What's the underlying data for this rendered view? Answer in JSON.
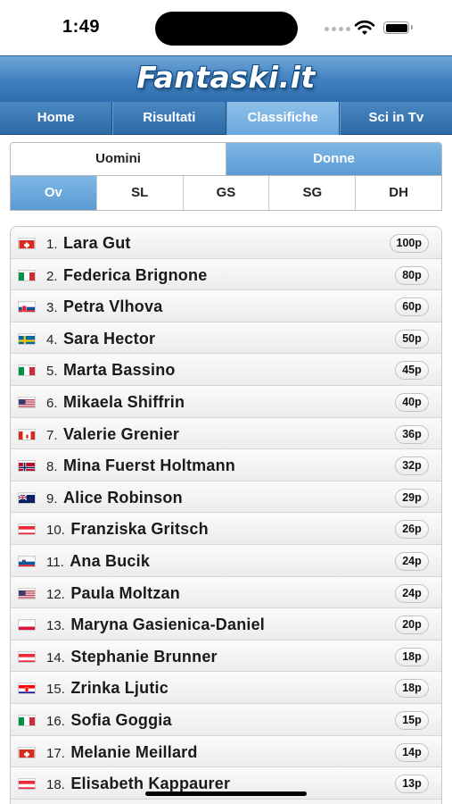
{
  "status_bar": {
    "time": "1:49",
    "icons": [
      "signal-dots-icon",
      "wifi-icon",
      "battery-icon"
    ]
  },
  "header": {
    "logo_text": "Fantaski.it",
    "nav": [
      {
        "label": "Home",
        "active": false
      },
      {
        "label": "Risultati",
        "active": false
      },
      {
        "label": "Classifiche",
        "active": true
      },
      {
        "label": "Sci in Tv",
        "active": false
      }
    ]
  },
  "gender_tabs": [
    {
      "label": "Uomini",
      "active": false
    },
    {
      "label": "Donne",
      "active": true
    }
  ],
  "discipline_tabs": [
    {
      "label": "Ov",
      "active": true
    },
    {
      "label": "SL",
      "active": false
    },
    {
      "label": "GS",
      "active": false
    },
    {
      "label": "SG",
      "active": false
    },
    {
      "label": "DH",
      "active": false
    }
  ],
  "ranking": [
    {
      "rank": "1.",
      "name": "Lara Gut",
      "points": "100p",
      "flag": "SUI"
    },
    {
      "rank": "2.",
      "name": "Federica Brignone",
      "points": "80p",
      "flag": "ITA"
    },
    {
      "rank": "3.",
      "name": "Petra Vlhova",
      "points": "60p",
      "flag": "SVK"
    },
    {
      "rank": "4.",
      "name": "Sara Hector",
      "points": "50p",
      "flag": "SWE"
    },
    {
      "rank": "5.",
      "name": "Marta Bassino",
      "points": "45p",
      "flag": "ITA"
    },
    {
      "rank": "6.",
      "name": "Mikaela Shiffrin",
      "points": "40p",
      "flag": "USA"
    },
    {
      "rank": "7.",
      "name": "Valerie Grenier",
      "points": "36p",
      "flag": "CAN"
    },
    {
      "rank": "8.",
      "name": "Mina Fuerst Holtmann",
      "points": "32p",
      "flag": "NOR"
    },
    {
      "rank": "9.",
      "name": "Alice Robinson",
      "points": "29p",
      "flag": "NZL"
    },
    {
      "rank": "10.",
      "name": "Franziska Gritsch",
      "points": "26p",
      "flag": "AUT"
    },
    {
      "rank": "11.",
      "name": "Ana Bucik",
      "points": "24p",
      "flag": "SLO"
    },
    {
      "rank": "12.",
      "name": "Paula Moltzan",
      "points": "24p",
      "flag": "USA"
    },
    {
      "rank": "13.",
      "name": "Maryna Gasienica-Daniel",
      "points": "20p",
      "flag": "POL"
    },
    {
      "rank": "14.",
      "name": "Stephanie Brunner",
      "points": "18p",
      "flag": "AUT"
    },
    {
      "rank": "15.",
      "name": "Zrinka Ljutic",
      "points": "18p",
      "flag": "CRO"
    },
    {
      "rank": "16.",
      "name": "Sofia Goggia",
      "points": "15p",
      "flag": "ITA"
    },
    {
      "rank": "17.",
      "name": "Melanie Meillard",
      "points": "14p",
      "flag": "SUI"
    },
    {
      "rank": "18.",
      "name": "Elisabeth Kappaurer",
      "points": "13p",
      "flag": "AUT"
    }
  ]
}
